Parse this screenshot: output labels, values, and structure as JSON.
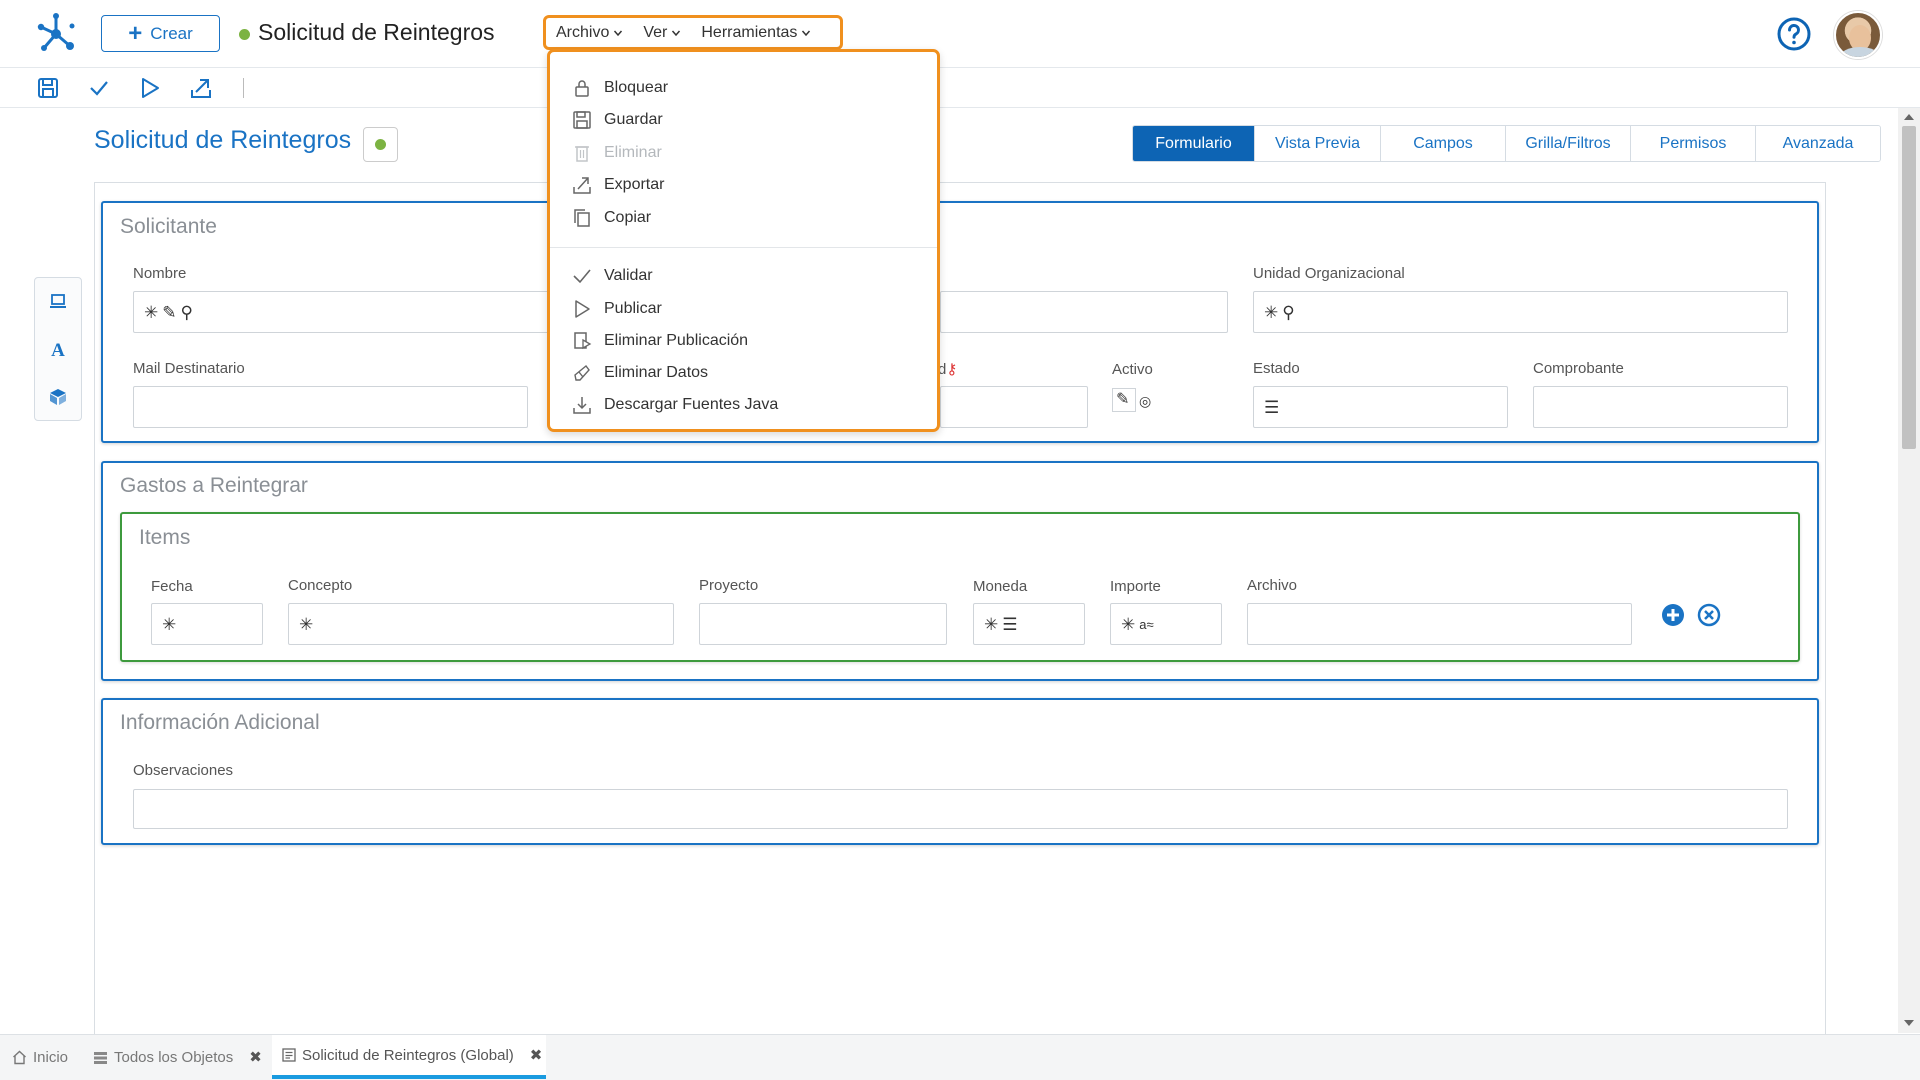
{
  "header": {
    "create_label": "Crear",
    "title": "Solicitud de Reintegros",
    "menus": [
      {
        "label": "Archivo"
      },
      {
        "label": "Ver"
      },
      {
        "label": "Herramientas"
      }
    ]
  },
  "page": {
    "title": "Solicitud de Reintegros",
    "status_color": "#7cb342",
    "tabs": [
      "Formulario",
      "Vista Previa",
      "Campos",
      "Grilla/Filtros",
      "Permisos",
      "Avanzada"
    ],
    "active_tab": "Formulario"
  },
  "dropdown": {
    "group1": [
      {
        "label": "Bloquear",
        "icon": "lock-icon",
        "disabled": false
      },
      {
        "label": "Guardar",
        "icon": "save-icon",
        "disabled": false
      },
      {
        "label": "Eliminar",
        "icon": "trash-icon",
        "disabled": true
      },
      {
        "label": "Exportar",
        "icon": "export-icon",
        "disabled": false
      },
      {
        "label": "Copiar",
        "icon": "copy-icon",
        "disabled": false
      }
    ],
    "group2": [
      {
        "label": "Validar",
        "icon": "check-icon",
        "disabled": false
      },
      {
        "label": "Publicar",
        "icon": "play-icon",
        "disabled": false
      },
      {
        "label": "Eliminar Publicación",
        "icon": "unpublish-icon",
        "disabled": false
      },
      {
        "label": "Eliminar Datos",
        "icon": "eraser-icon",
        "disabled": false
      },
      {
        "label": "Descargar Fuentes Java",
        "icon": "download-icon",
        "disabled": false
      }
    ]
  },
  "sections": {
    "solicitante": {
      "title": "Solicitante",
      "nombre_label": "Nombre",
      "unidad_label": "Unidad Organizacional",
      "mail_label": "Mail Destinatario",
      "activo_label": "Activo",
      "estado_label": "Estado",
      "comprobante_label": "Comprobante",
      "partial_label": "d"
    },
    "gastos": {
      "title": "Gastos a Reintegrar",
      "items_title": "Items",
      "fecha_label": "Fecha",
      "concepto_label": "Concepto",
      "proyecto_label": "Proyecto",
      "moneda_label": "Moneda",
      "importe_label": "Importe",
      "archivo_label": "Archivo"
    },
    "info": {
      "title": "Información Adicional",
      "observaciones_label": "Observaciones"
    }
  },
  "bottom_tabs": [
    {
      "label": "Inicio",
      "icon": "home-icon"
    },
    {
      "label": "Todos los Objetos",
      "icon": "list-icon"
    },
    {
      "label": "Solicitud de Reintegros (Global)",
      "icon": "form-icon"
    }
  ],
  "colors": {
    "primary": "#1a73c4",
    "highlight": "#f0901e",
    "items_border": "#3d9a3d",
    "status": "#7cb342"
  }
}
